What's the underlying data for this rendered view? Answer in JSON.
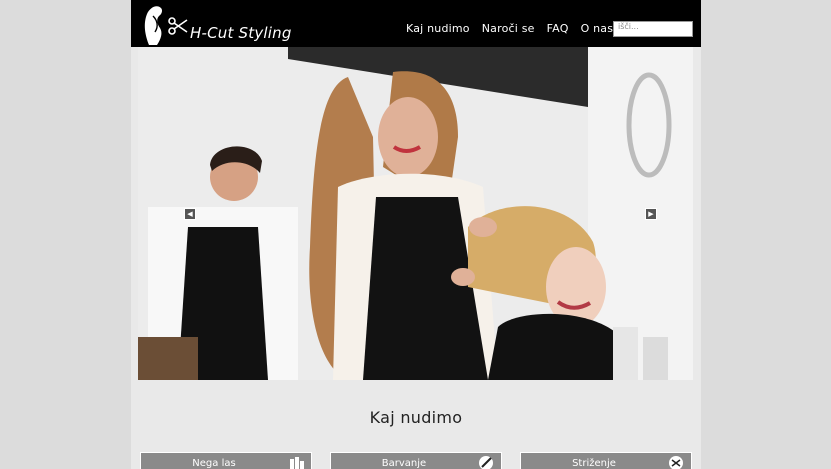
{
  "header": {
    "brand": "H-Cut Styling",
    "nav": [
      "Kaj nudimo",
      "Naroči se",
      "FAQ",
      "O nas"
    ],
    "search_placeholder": "išči..."
  },
  "slider": {
    "prev_icon": "arrow-left-icon",
    "next_icon": "arrow-right-icon"
  },
  "section": {
    "title": "Kaj nudimo"
  },
  "services": [
    {
      "label": "Nega las",
      "icon": "hair-products-icon"
    },
    {
      "label": "Barvanje",
      "icon": "hair-dye-brush-icon"
    },
    {
      "label": "Striženje",
      "icon": "scissors-icon"
    }
  ]
}
